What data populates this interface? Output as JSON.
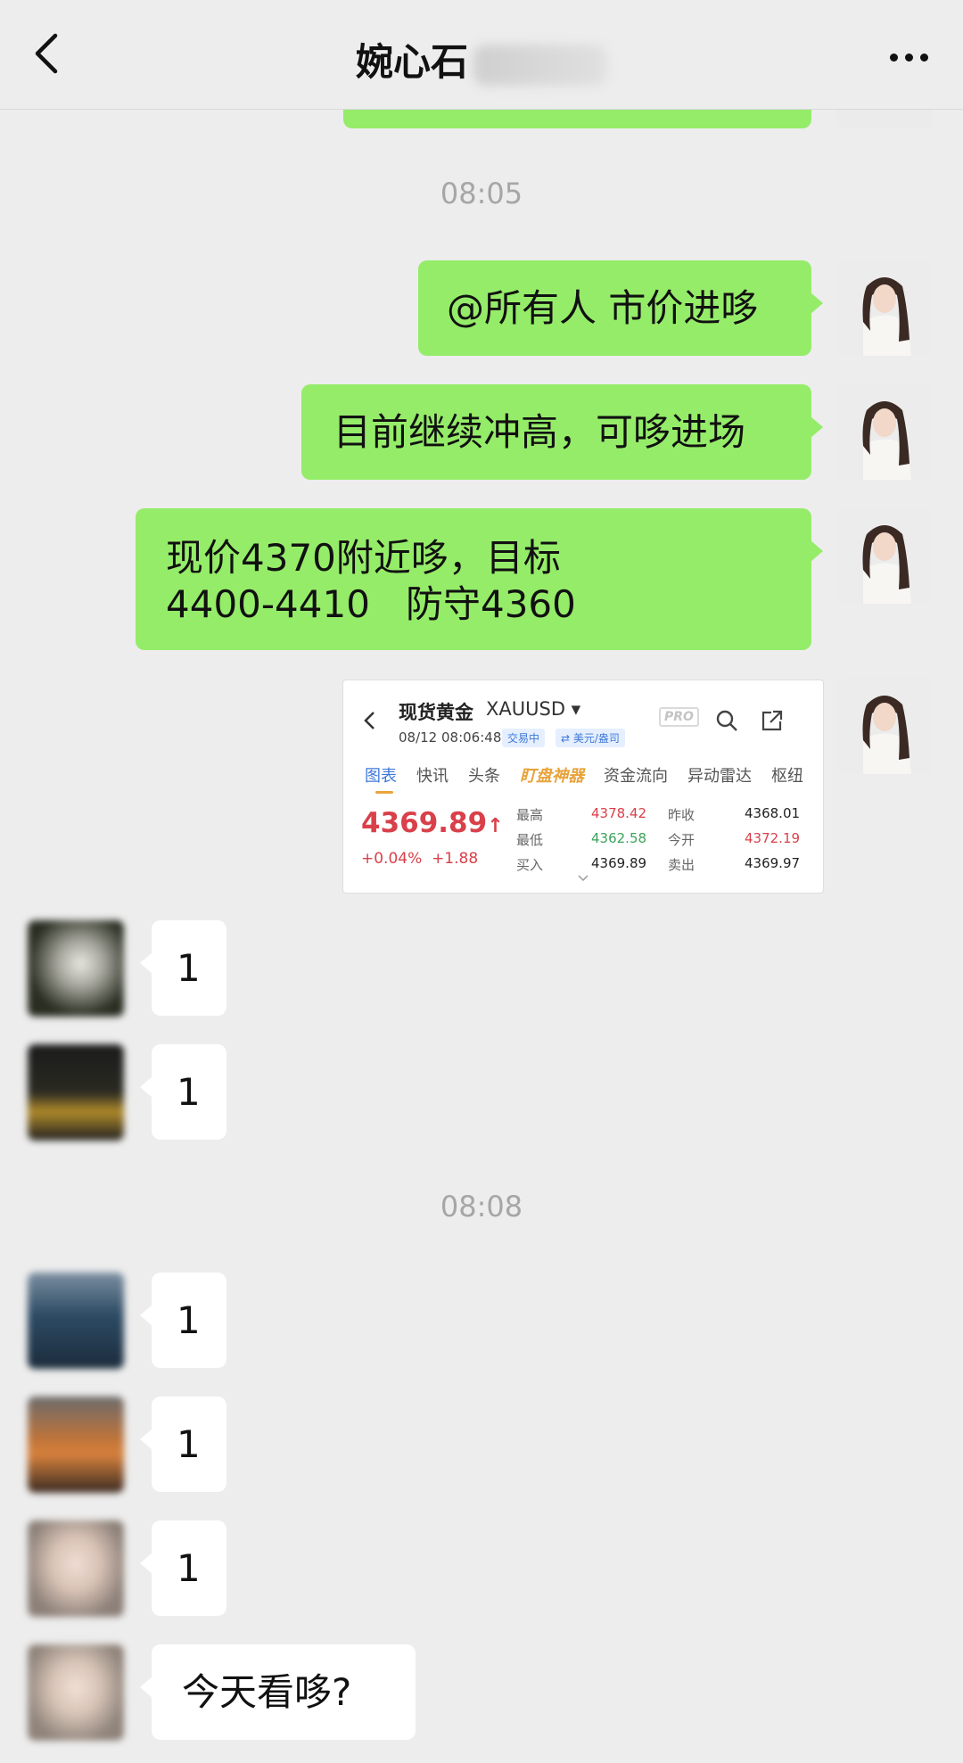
{
  "header": {
    "title": "婉心石"
  },
  "chat": {
    "timestamps": [
      "08:05",
      "08:08"
    ],
    "messages_out": [
      "@所有人 市价进哆",
      "目前继续冲高，可哆进场",
      "现价4370附近哆，目标",
      "4400-4410   防守4360"
    ],
    "messages_in": [
      "1",
      "1",
      "1",
      "1",
      "1",
      "今天看哆?"
    ]
  },
  "market_card": {
    "name": "现货黄金",
    "code": "XAUUSD",
    "datetime": "08/12 08:06:48",
    "tag_trading": "交易中",
    "tag_unit": "⇄ 美元/盎司",
    "pro_label": "PRO",
    "tabs": [
      "图表",
      "快讯",
      "头条",
      "盯盘神器",
      "资金流向",
      "异动雷达",
      "枢纽"
    ],
    "price": "4369.89",
    "change_pct": "+0.04%",
    "change_abs": "+1.88",
    "stats": {
      "high_label": "最高",
      "high": "4378.42",
      "low_label": "最低",
      "low": "4362.58",
      "buy_label": "买入",
      "buy": "4369.89",
      "prev_close_label": "昨收",
      "prev_close": "4368.01",
      "open_label": "今开",
      "open": "4372.19",
      "sell_label": "卖出",
      "sell": "4369.97"
    }
  },
  "colors": {
    "background": "#ededed",
    "bubble_out": "#95ec69",
    "bubble_in": "#ffffff",
    "price_up": "#d9404a",
    "price_down": "#3aa35a"
  }
}
